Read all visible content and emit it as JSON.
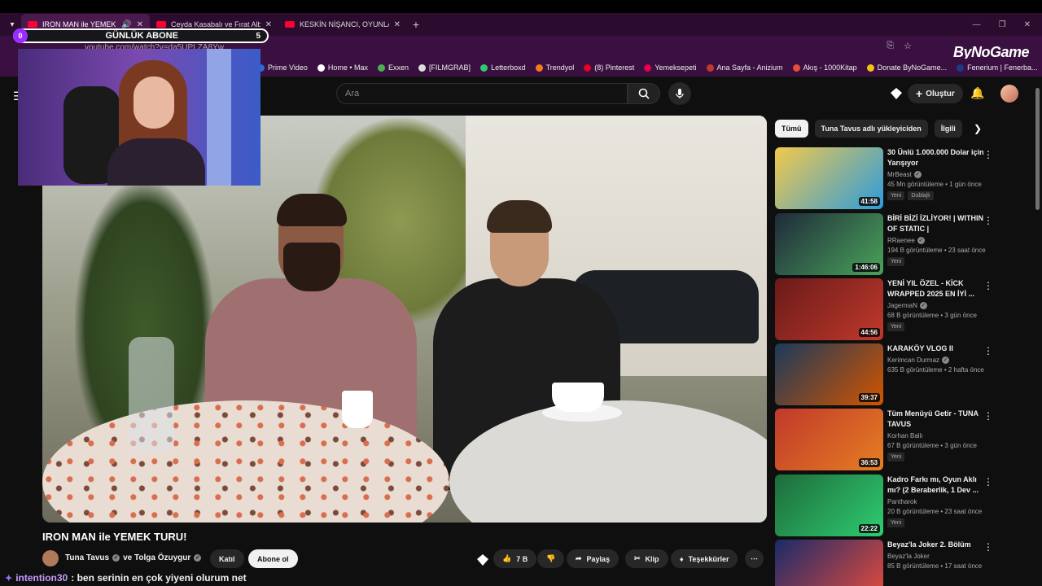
{
  "browser": {
    "tabs": [
      {
        "title": "IRON MAN ile YEMEK TURU",
        "active": true
      },
      {
        "title": "Ceyda Kasabalı ve Fırat Albayrak",
        "active": false
      },
      {
        "title": "KESKİN NİŞANCI, OYUNLARDAN",
        "active": false
      }
    ],
    "url": "youtube.com/watch?v=da5UPLZA8Yw",
    "bookmarks": [
      "Prime Video",
      "Home • Max",
      "Exxen",
      "[FILMGRAB]",
      "Letterboxd",
      "Trendyol",
      "(8) Pinterest",
      "Yemeksepeti",
      "Ana Sayfa - Anizium",
      "Akış - 1000Kitap",
      "Donate ByNoGame...",
      "Fenerium | Fenerba..."
    ],
    "brand": "ByNoGame"
  },
  "overlay": {
    "sub_count": "0",
    "sub_label": "GÜNLÜK ABONE",
    "sub_goal": "5"
  },
  "youtube": {
    "search_placeholder": "Ara",
    "create_label": "Oluştur",
    "video": {
      "title": "IRON MAN ile YEMEK TURU!",
      "channel": "Tuna Tavus",
      "collab_text": "ve Tolga Özuygur",
      "join_label": "Katıl",
      "subscribe_label": "Abone ol",
      "likes": "7 B",
      "share_label": "Paylaş",
      "clip_label": "Klip",
      "thanks_label": "Teşekkürler"
    },
    "chips": [
      "Tümü",
      "Tuna Tavus adlı yükleyiciden",
      "İlgili"
    ],
    "recommendations": [
      {
        "title": "30 Ünlü 1.000.000 Dolar için Yarışıyor",
        "channel": "MrBeast",
        "verified": true,
        "meta": "45 Mn görüntüleme • 1 gün önce",
        "badges": [
          "Yeni",
          "Dublajlı"
        ],
        "duration": "41:58",
        "thumb_colors": [
          "#f2c94c",
          "#2d9cdb"
        ]
      },
      {
        "title": "BİRİ BİZİ İZLİYOR! | WITHIN OF STATIC |",
        "channel": "RRaenee",
        "verified": true,
        "meta": "194 B görüntüleme • 23 saat önce",
        "badges": [
          "Yeni"
        ],
        "duration": "1:46:06",
        "thumb_colors": [
          "#1e2a3a",
          "#4aa35a"
        ]
      },
      {
        "title": "YENİ YIL ÖZEL - KİCK WRAPPED 2025 EN İYİ ...",
        "channel": "JagermaN",
        "verified": true,
        "meta": "68 B görüntüleme • 3 gün önce",
        "badges": [
          "Yeni"
        ],
        "duration": "44:56",
        "thumb_colors": [
          "#6a1a1a",
          "#c0392b"
        ]
      },
      {
        "title": "KARAKÖY VLOG II",
        "channel": "Kerimcan Durmaz",
        "verified": true,
        "meta": "635 B görüntüleme • 2 hafta önce",
        "badges": [],
        "duration": "39:37",
        "thumb_colors": [
          "#1a3a5a",
          "#d35400"
        ]
      },
      {
        "title": "Tüm Menüyü Getir - TUNA TAVUS",
        "channel": "Korhan Ballı",
        "verified": false,
        "meta": "67 B görüntüleme • 3 gün önce",
        "badges": [
          "Yeni"
        ],
        "duration": "36:53",
        "thumb_colors": [
          "#c0392b",
          "#e67e22"
        ]
      },
      {
        "title": "Kadro Farkı mı, Oyun Aklı mı? (2 Beraberlik, 1 Dev ...",
        "channel": "Pantharok",
        "verified": false,
        "meta": "20 B görüntüleme • 23 saat önce",
        "badges": [
          "Yeni"
        ],
        "duration": "22:22",
        "thumb_colors": [
          "#1e6b3a",
          "#2ecc71"
        ]
      },
      {
        "title": "Beyaz'la Joker 2. Bölüm",
        "channel": "Beyaz'la Joker",
        "verified": false,
        "meta": "85 B görüntüleme • 17 saat önce",
        "badges": [],
        "duration": "",
        "thumb_colors": [
          "#1a2a6a",
          "#e74c3c"
        ]
      }
    ]
  },
  "chat": {
    "user": "intention30",
    "message": ": ben serinin en çok yiyeni olurum net"
  },
  "colors": {
    "tabbar": "#2b0b2e",
    "toolbar": "#3a1040",
    "yt_bg": "#0f0f0f",
    "yt_red": "#ff0033",
    "chat_user": "#c69bff"
  }
}
